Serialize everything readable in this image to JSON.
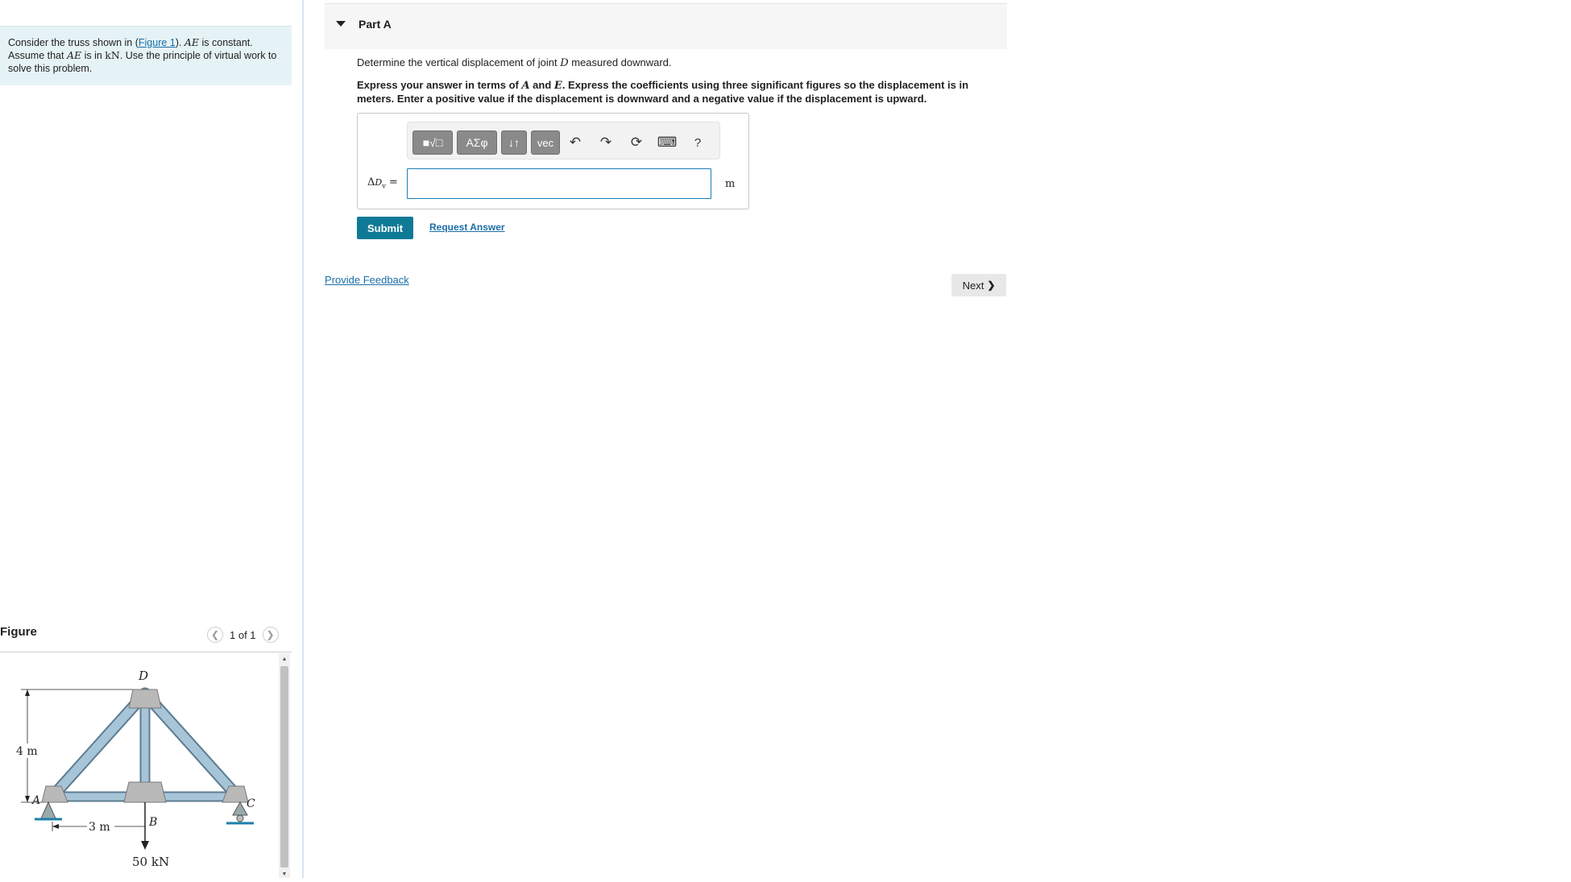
{
  "problem": {
    "intro": "Consider the truss shown in (",
    "figure_link": "Figure 1",
    "after_link": "). ",
    "AE1": "AE",
    "text2": " is constant. Assume that ",
    "AE2": "AE",
    "text3": " is in ",
    "kN": "kN",
    "text4": ". Use the principle of virtual work to solve this problem."
  },
  "figure": {
    "label": "Figure",
    "pager": "1 of 1",
    "labels": {
      "D": "D",
      "A": "A",
      "B": "B",
      "C": "C",
      "height": "4 m",
      "span": "3 m",
      "load": "50 kN"
    }
  },
  "part": {
    "title": "Part A"
  },
  "question": {
    "pre": "Determine the vertical displacement of joint ",
    "D": "D",
    "post": " measured downward."
  },
  "instructions": {
    "t1": "Express your answer in terms of ",
    "A": "A",
    "t2": " and ",
    "E": "E",
    "t3": ". Express the coefficients using three significant figures so the displacement is in meters. Enter a positive value if the displacement is downward and a negative value if the displacement is upward."
  },
  "toolbar": {
    "templates": "■√□",
    "greek": "ΑΣφ",
    "arrows": "↓↑",
    "vec": "vec",
    "undo": "↶",
    "redo": "↷",
    "reset": "⟳",
    "keyboard": "⌨",
    "help": "?"
  },
  "answer": {
    "var_delta": "Δ",
    "var_D": "D",
    "var_sub": "v",
    "equals": "=",
    "value": "",
    "unit": "m"
  },
  "buttons": {
    "submit": "Submit",
    "request_answer": "Request Answer",
    "provide_feedback": "Provide Feedback",
    "next": "Next",
    "next_icon": "❯"
  }
}
